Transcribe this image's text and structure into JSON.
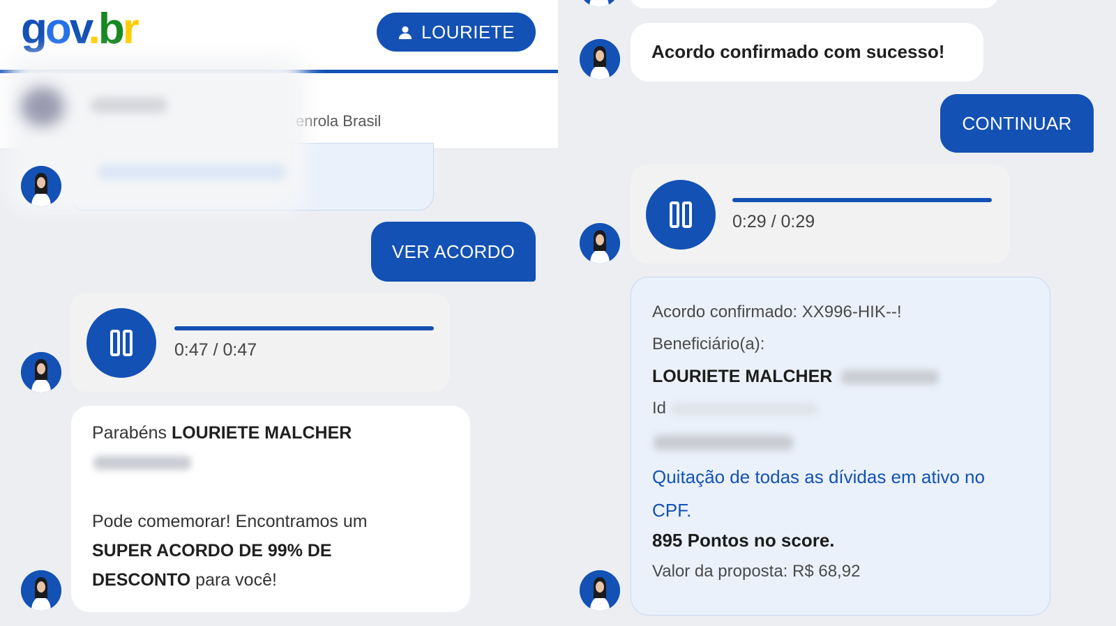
{
  "left": {
    "header": {
      "logo": {
        "g": "g",
        "o": "o",
        "v": "v",
        "dot": ".",
        "b": "b",
        "r": "r"
      },
      "user_button_label": "LOURIETE",
      "sub_text": "enrola Brasil"
    },
    "ver_acordo_label": "VER ACORDO",
    "audio": {
      "time": "0:47 / 0:47",
      "progress": 1.0
    },
    "congrats": {
      "prefix": "Parabéns ",
      "name": "LOURIETE MALCHER",
      "line1": "Pode comemorar! Encontramos um",
      "bold_offer_1": "SUPER ACORDO DE 99% DE",
      "bold_offer_2": "DESCONTO",
      "suffix": " para você!"
    }
  },
  "right": {
    "success_message": "Acordo confirmado com sucesso!",
    "continuar_label": "CONTINUAR",
    "audio": {
      "time": "0:29 / 0:29",
      "progress": 1.0
    },
    "details": {
      "confirm_line": "Acordo confirmado: XX996-HIK--!",
      "beneficiary_label": "Beneficiário(a):",
      "beneficiary_name": "LOURIETE MALCHER",
      "id_prefix": "Id",
      "quitacao_1": "Quitação de todas as dívidas em ativo no",
      "quitacao_2": "CPF.",
      "score": "895 Pontos no score.",
      "valor": "Valor da proposta: R$ 68,92"
    }
  },
  "colors": {
    "brand_blue": "#1351b4",
    "background": "#eceef2"
  },
  "icons": [
    "user-icon",
    "pause-icon",
    "avatar-icon"
  ]
}
